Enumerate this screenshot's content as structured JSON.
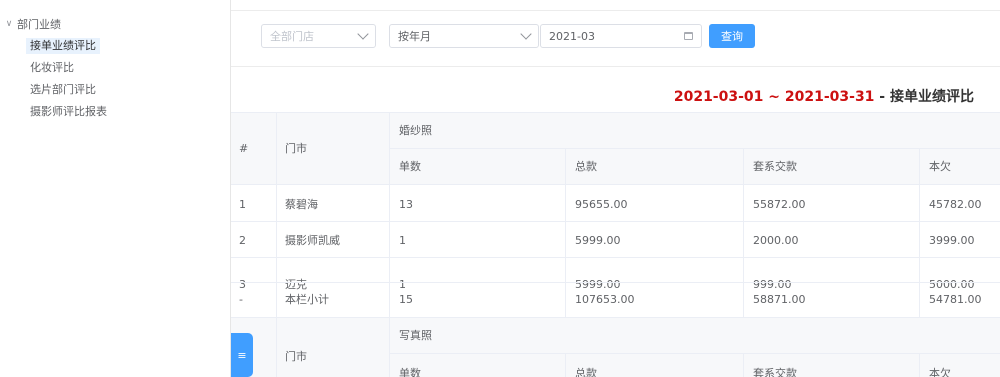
{
  "sidebar": {
    "parent_label": "部门业绩",
    "items": [
      {
        "label": "接单业绩评比",
        "active": true
      },
      {
        "label": "化妆评比",
        "active": false
      },
      {
        "label": "选片部门评比",
        "active": false
      },
      {
        "label": "摄影师评比报表",
        "active": false
      }
    ]
  },
  "filters": {
    "store_placeholder": "全部门店",
    "period_value": "按年月",
    "month_value": "2021-03",
    "query_label": "查询"
  },
  "report": {
    "title_range": "2021-03-01 ~ 2021-03-31",
    "title_suffix": " - 接单业绩评比"
  },
  "table": {
    "col_index": "#",
    "col_store": "门市",
    "group1": {
      "name": "婚纱照",
      "subheaders": [
        "单数",
        "总款",
        "套系交款",
        "本欠"
      ],
      "rows": [
        [
          "1",
          "蔡碧海",
          "13",
          "95655.00",
          "55872.00",
          "45782.00"
        ],
        [
          "2",
          "摄影师凯威",
          "1",
          "5999.00",
          "2000.00",
          "3999.00"
        ],
        [
          "3",
          "迈克",
          "1",
          "5999.00",
          "999.00",
          "5000.00"
        ],
        [
          "-",
          "本栏小计",
          "15",
          "107653.00",
          "58871.00",
          "54781.00"
        ]
      ]
    },
    "group2": {
      "name": "写真照",
      "subheaders": [
        "单数",
        "总款",
        "套系交款",
        "本欠"
      ]
    }
  },
  "floating_button": {
    "icon": "menu-icon",
    "glyph": "≡"
  }
}
